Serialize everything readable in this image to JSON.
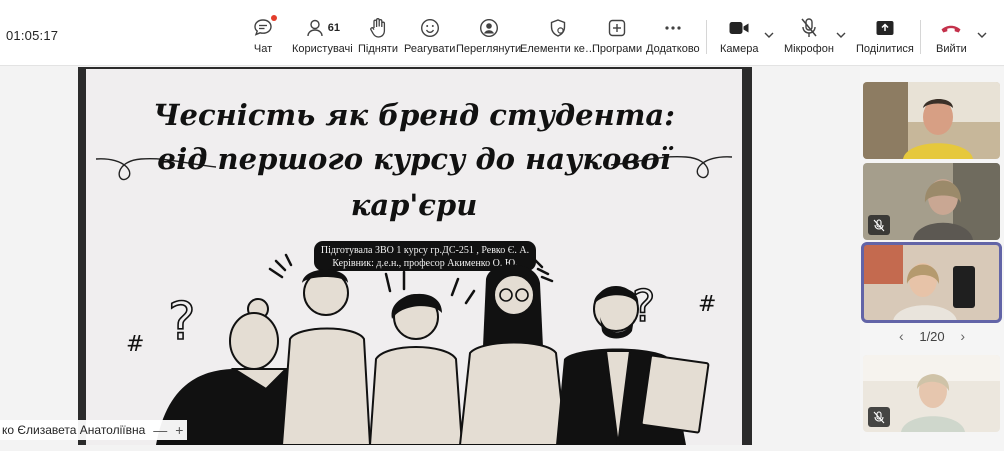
{
  "meeting": {
    "elapsed_time": "01:05:17"
  },
  "toolbar": {
    "chat_label": "Чат",
    "participants_label": "Користувачі",
    "participants_count": "61",
    "raise_label": "Підняти",
    "react_label": "Реагувати",
    "view_label": "Переглянути",
    "elements_label": "Елементи ке…",
    "apps_label": "Програми",
    "more_label": "Додатково",
    "camera_label": "Камера",
    "mic_label": "Мікрофон",
    "share_label": "Поділитися",
    "leave_label": "Вийти",
    "colors": {
      "leave": "#c4314b",
      "accent": "#6264a7",
      "notify": "#e33d2b"
    }
  },
  "slide": {
    "title_line1": "Чесність як бренд студента:",
    "title_line2": "від першого курсу до наукової",
    "title_line3": "кар'єри",
    "prepared_by": "Підготувала ЗВО 1 курсу гр.ДС-251 , Ревко Є. А.",
    "supervisor": "Керівник: д.е.н., професор Акименко О. Ю."
  },
  "presenter": {
    "name": "ко Єлизавета Анатоліївна",
    "minimize_icon": "minus-icon",
    "expand_icon": "plus-icon"
  },
  "gallery": {
    "page_indicator": "1/20",
    "prev_icon": "chevron-left-icon",
    "next_icon": "chevron-right-icon"
  }
}
